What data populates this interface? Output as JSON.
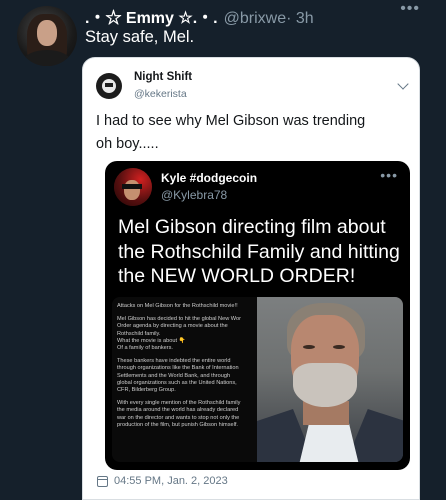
{
  "tweet": {
    "display_name": ".・☆ Emmy ☆.・.",
    "handle": "@brixwe",
    "time": "· 3h",
    "more": "•••",
    "text": "Stay safe, Mel."
  },
  "quoted": {
    "display_name": "Night Shift",
    "handle": "@kekerista",
    "text_line1": "I had to see why Mel Gibson was trending",
    "text_line2": "oh boy.....",
    "timestamp": "04:55 PM, Jan. 2, 2023",
    "inner": {
      "display_name": "Kyle #dodgecoin",
      "handle": "@Kylebra78",
      "more": "•••",
      "headline": "Mel Gibson directing film about the Rothschild Family and hitting the NEW WORLD ORDER!",
      "article_paragraphs": [
        "Attacks on Mel Gibson for the Rothschild movie!!",
        "Mel Gibson has decided to hit the global New Wor\nOrder agenda by directing a movie about the\nRothschild family.\nWhat the movie is about 👇\nOf a family of bankers.",
        "These bankers have indebted the entire world\nthrough organizations like the Bank of Internation\nSettlements and the World Bank, and through\nglobal organizations such as the United Nations,\nCFR, Bilderberg Group.",
        "With every single mention of the Rothschild family\nthe media around the world has already declared\nwar on the director and wants to stop not only the\nproduction of the film, but punish Gibson himself."
      ]
    }
  },
  "colors": {
    "background": "#15202b",
    "card": "#ffffff",
    "inner_card": "#000000",
    "muted": "#8899a6"
  }
}
